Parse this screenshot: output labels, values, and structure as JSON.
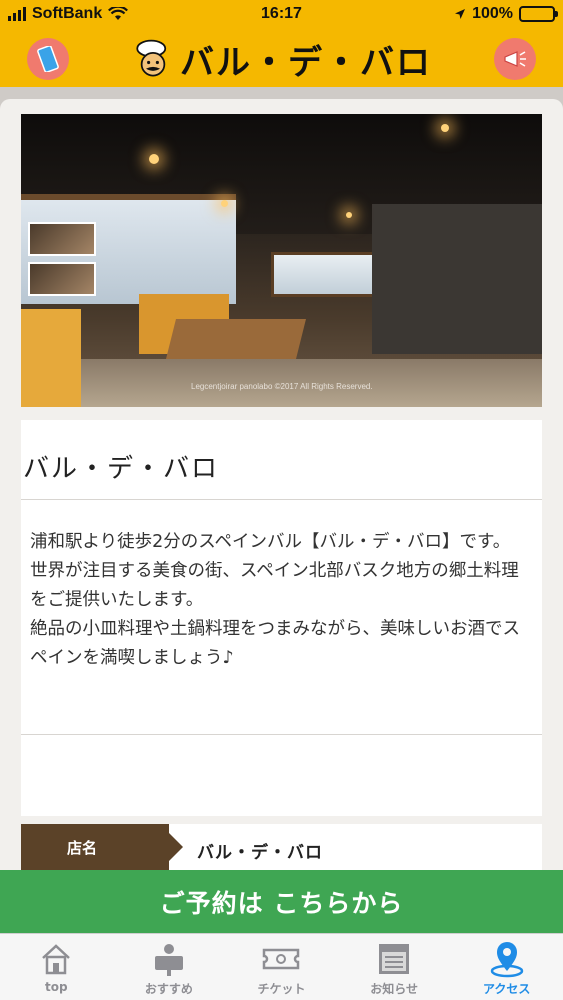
{
  "status_bar": {
    "carrier": "SoftBank",
    "time": "16:17",
    "battery": "100%"
  },
  "header": {
    "logo_text": "バル・デ・バロ",
    "left_icon": "phone-icon",
    "right_icon": "megaphone-icon"
  },
  "photo": {
    "credit": "Legcentjoirar panolabo ©2017 All Rights Reserved."
  },
  "shop": {
    "title": "バル・デ・バロ",
    "description": [
      "浦和駅より徒歩2分のスペインバル【バル・デ・バロ】です。",
      "世界が注目する美食の街、スペイン北部バスク地方の郷土料理をご提供いたします。",
      "絶品の小皿料理や土鍋料理をつまみながら、美味しいお酒でスペインを満喫しましょう♪"
    ]
  },
  "details": [
    {
      "label": "店名",
      "value": "バル・デ・バロ"
    }
  ],
  "reserve_button": "ご予約は こちらから",
  "tabs": [
    {
      "label": "top",
      "icon": "home-icon",
      "active": false
    },
    {
      "label": "おすすめ",
      "icon": "recommend-icon",
      "active": false
    },
    {
      "label": "チケット",
      "icon": "ticket-icon",
      "active": false
    },
    {
      "label": "お知らせ",
      "icon": "news-icon",
      "active": false
    },
    {
      "label": "アクセス",
      "icon": "location-pin-icon",
      "active": true
    }
  ],
  "colors": {
    "header_bg": "#f5b800",
    "accent_green": "#3fa653",
    "active_tab": "#1f8ce6",
    "label_brown": "#5b4228",
    "header_button": "#f07a6e"
  }
}
